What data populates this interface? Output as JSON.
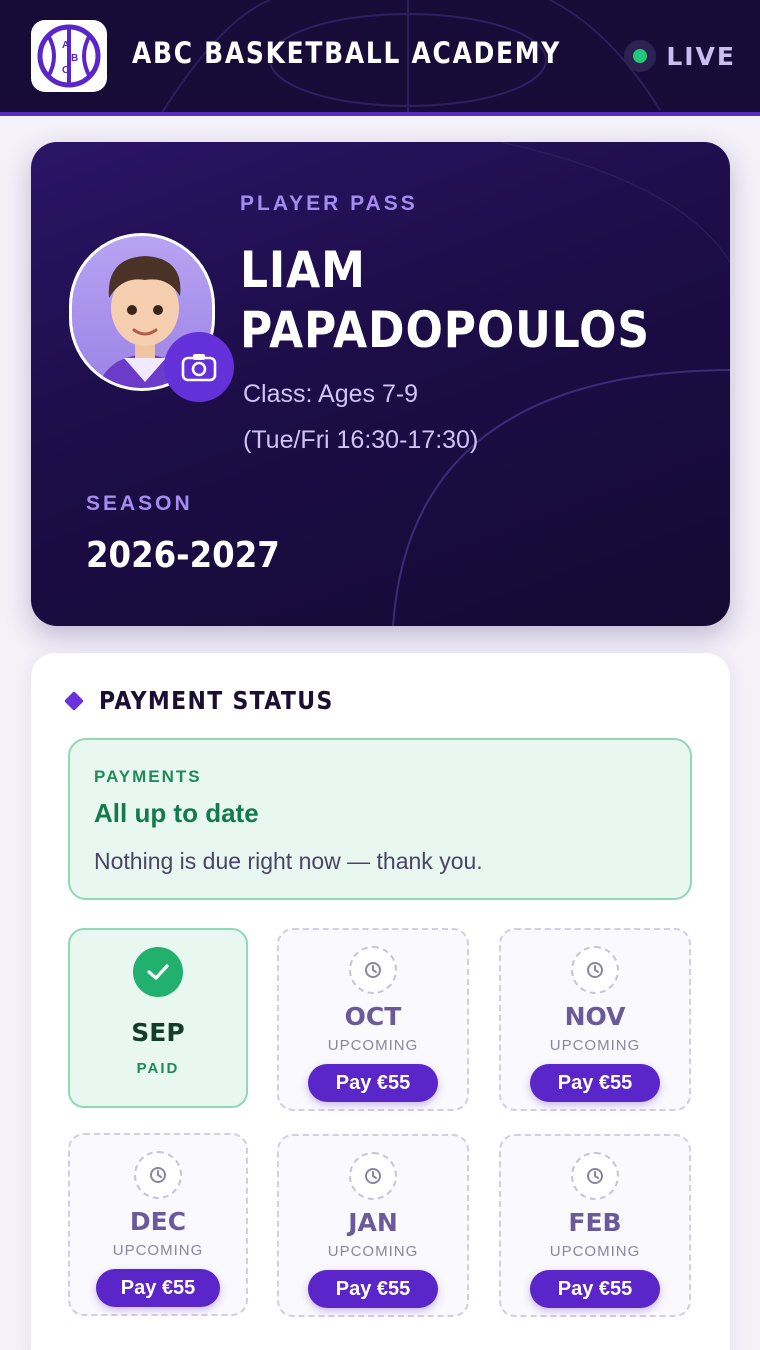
{
  "header": {
    "title": "ABC BASKETBALL ACADEMY",
    "logo_letters": "ABC",
    "live_label": "LIVE"
  },
  "pass": {
    "label": "PLAYER PASS",
    "first_name": "LIAM",
    "last_name": "PAPADOPOULOS",
    "class_line": "Class: Ages 7-9",
    "schedule_line": "(Tue/Fri 16:30-17:30)",
    "season_label": "SEASON",
    "season_value": "2026-2027"
  },
  "payments": {
    "section_title": "PAYMENT STATUS",
    "summary_label": "PAYMENTS",
    "summary_title": "All up to date",
    "summary_text": "Nothing is due right now — thank you.",
    "months": [
      {
        "name": "SEP",
        "status": "PAID"
      },
      {
        "name": "OCT",
        "status": "UPCOMING",
        "button": "Pay €55"
      },
      {
        "name": "NOV",
        "status": "UPCOMING",
        "button": "Pay €55"
      },
      {
        "name": "DEC",
        "status": "UPCOMING",
        "button": "Pay €55"
      },
      {
        "name": "JAN",
        "status": "UPCOMING",
        "button": "Pay €55"
      },
      {
        "name": "FEB",
        "status": "UPCOMING",
        "button": "Pay €55"
      }
    ]
  },
  "colors": {
    "header_bg": "#170b38",
    "accent": "#5a26c9",
    "paid_green": "#22b06f",
    "live_green": "#22c77a"
  }
}
